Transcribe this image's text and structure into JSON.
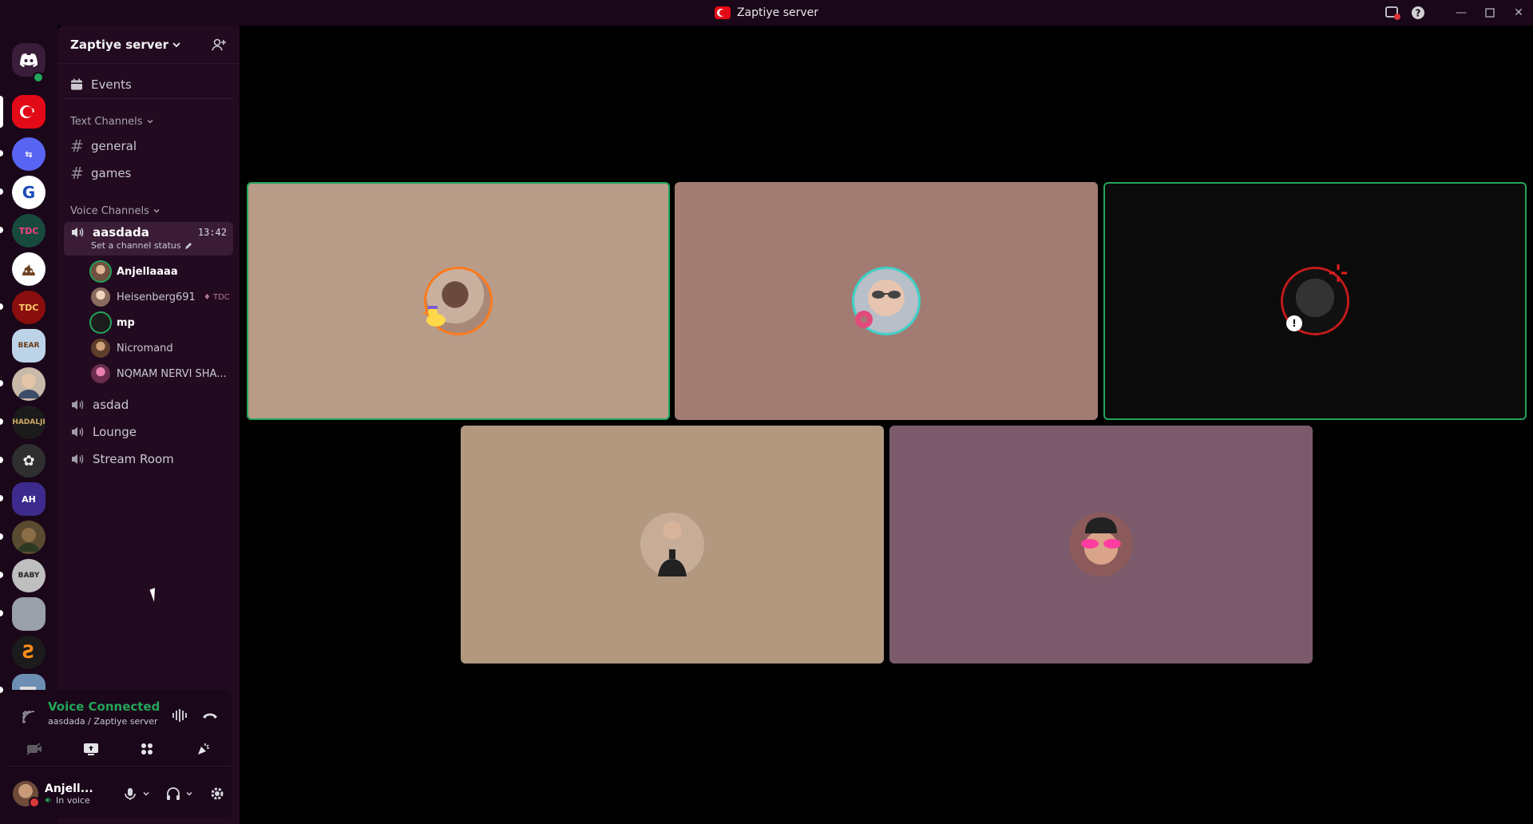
{
  "window": {
    "title": "Zaptiye server"
  },
  "server": {
    "name": "Zaptiye server"
  },
  "sidebar": {
    "events_label": "Events",
    "text_category": "Text Channels",
    "text_channels": [
      "general",
      "games"
    ],
    "voice_category": "Voice Channels",
    "active_voice": {
      "name": "aasdada",
      "timer": "13:42",
      "status": "Set a channel status"
    },
    "members": [
      {
        "name": "Anjellaaaa",
        "speaking": true,
        "bold": true
      },
      {
        "name": "Heisenberg691",
        "speaking": false,
        "bold": false,
        "tag": "TDC"
      },
      {
        "name": "mp",
        "speaking": true,
        "bold": true
      },
      {
        "name": "Nicromand",
        "speaking": false,
        "bold": false
      },
      {
        "name": "NQMAM NERVI SHA...",
        "speaking": false,
        "bold": false
      }
    ],
    "voice_channels": [
      "asdad",
      "Lounge",
      "Stream Room"
    ]
  },
  "voice_panel": {
    "title": "Voice Connected",
    "subtitle": "aasdada / Zaptiye server"
  },
  "user": {
    "name": "Anjell...",
    "status": "In voice"
  },
  "colors": {
    "speaking": "#23a55a",
    "tile_1": "#b89c88",
    "tile_2": "#a27b73",
    "tile_3": "#0b0b0b",
    "tile_4": "#b39880",
    "tile_5": "#7b5a6b"
  }
}
